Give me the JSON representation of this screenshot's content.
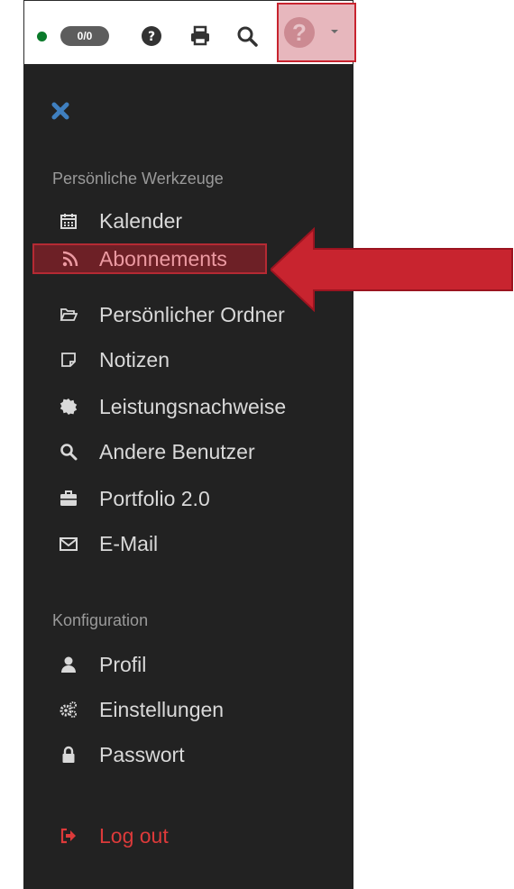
{
  "toolbar": {
    "status_color": "#0a7a2a",
    "counter_badge": "0/0",
    "icons": [
      "help-circle-icon",
      "print-icon",
      "search-icon"
    ],
    "help_menu": {
      "icon": "help-circle-icon",
      "dropdown": "caret-down-icon"
    }
  },
  "menu": {
    "close_icon": "close-x-icon",
    "sections": [
      {
        "title": "Persönliche Werkzeuge",
        "items": [
          {
            "icon": "calendar-icon",
            "label": "Kalender"
          },
          {
            "icon": "rss-icon",
            "label": "Abonnements",
            "selected": true
          },
          {
            "icon": "folder-open-icon",
            "label": "Persönlicher Ordner"
          },
          {
            "icon": "note-icon",
            "label": "Notizen"
          },
          {
            "icon": "badge-icon",
            "label": "Leistungsnachweise"
          },
          {
            "icon": "search-icon",
            "label": "Andere Benutzer"
          },
          {
            "icon": "briefcase-icon",
            "label": "Portfolio 2.0"
          },
          {
            "icon": "envelope-icon",
            "label": "E-Mail"
          }
        ]
      },
      {
        "title": "Konfiguration",
        "items": [
          {
            "icon": "user-icon",
            "label": "Profil"
          },
          {
            "icon": "gears-icon",
            "label": "Einstellungen"
          },
          {
            "icon": "lock-icon",
            "label": "Passwort"
          }
        ]
      }
    ],
    "logout": {
      "icon": "sign-out-icon",
      "label": "Log out",
      "color": "#dd3a3a"
    }
  },
  "annotation": {
    "arrow_color": "#c8242f"
  }
}
